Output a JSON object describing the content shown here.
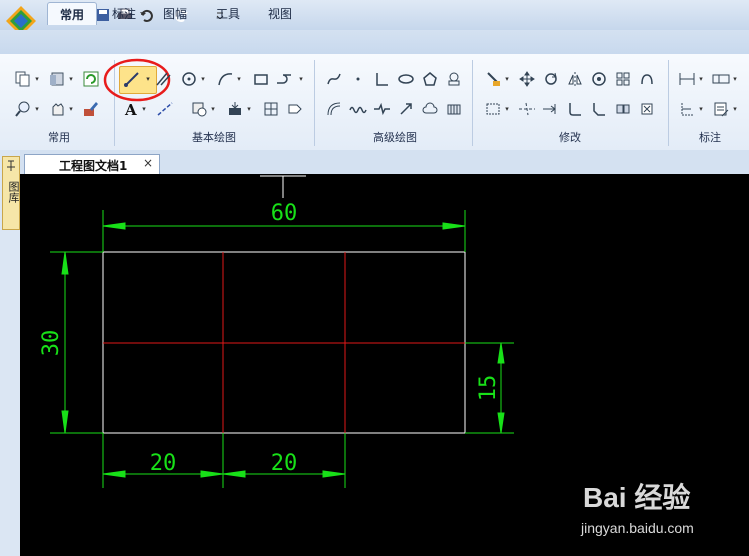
{
  "tabs": [
    {
      "label": "常用",
      "active": true
    },
    {
      "label": "标注",
      "active": false
    },
    {
      "label": "图幅",
      "active": false
    },
    {
      "label": "工具",
      "active": false
    },
    {
      "label": "视图",
      "active": false
    }
  ],
  "ribbon_groups": [
    "常用",
    "基本绘图",
    "高级绘图",
    "修改",
    "标注"
  ],
  "document": {
    "tab_title": "工程图文档1",
    "close_glyph": "×"
  },
  "side_panel": {
    "label": "图库"
  },
  "drawing": {
    "dim_total_width": "60",
    "dim_total_height": "30",
    "dim_lower_height": "15",
    "dim_left_segment": "20",
    "dim_middle_segment": "20"
  },
  "watermark": {
    "brand": "Bai 经验",
    "url": "jingyan.baidu.com"
  },
  "colors": {
    "dimension": "#18e018",
    "centerline": "#e01818",
    "outline": "#ffffff",
    "highlight": "#e81c1c",
    "canvas": "#000000"
  }
}
